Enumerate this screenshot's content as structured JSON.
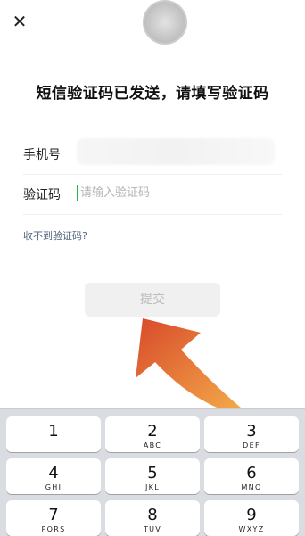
{
  "header": {
    "close_glyph": "✕",
    "title": "短信验证码已发送，请填写验证码"
  },
  "form": {
    "phone_label": "手机号",
    "code_label": "验证码",
    "code_placeholder": "请输入验证码",
    "code_value": ""
  },
  "links": {
    "not_received": "收不到验证码?"
  },
  "submit": {
    "label": "提交"
  },
  "keyboard": {
    "keys": [
      {
        "digit": "1",
        "letters": ""
      },
      {
        "digit": "2",
        "letters": "ABC"
      },
      {
        "digit": "3",
        "letters": "DEF"
      },
      {
        "digit": "4",
        "letters": "GHI"
      },
      {
        "digit": "5",
        "letters": "JKL"
      },
      {
        "digit": "6",
        "letters": "MNO"
      },
      {
        "digit": "7",
        "letters": "PQRS"
      },
      {
        "digit": "8",
        "letters": "TUV"
      },
      {
        "digit": "9",
        "letters": "WXYZ"
      }
    ]
  },
  "colors": {
    "accent": "#24b15b",
    "link": "#52647e",
    "button_bg": "#f0f0f0",
    "button_text": "#bcbcbc",
    "keyboard_bg": "#d9dce1",
    "arrow_start": "#d84a2b",
    "arrow_end": "#f6b24b"
  },
  "icons": {
    "close": "close-icon",
    "arrow": "curved-arrow-icon"
  }
}
